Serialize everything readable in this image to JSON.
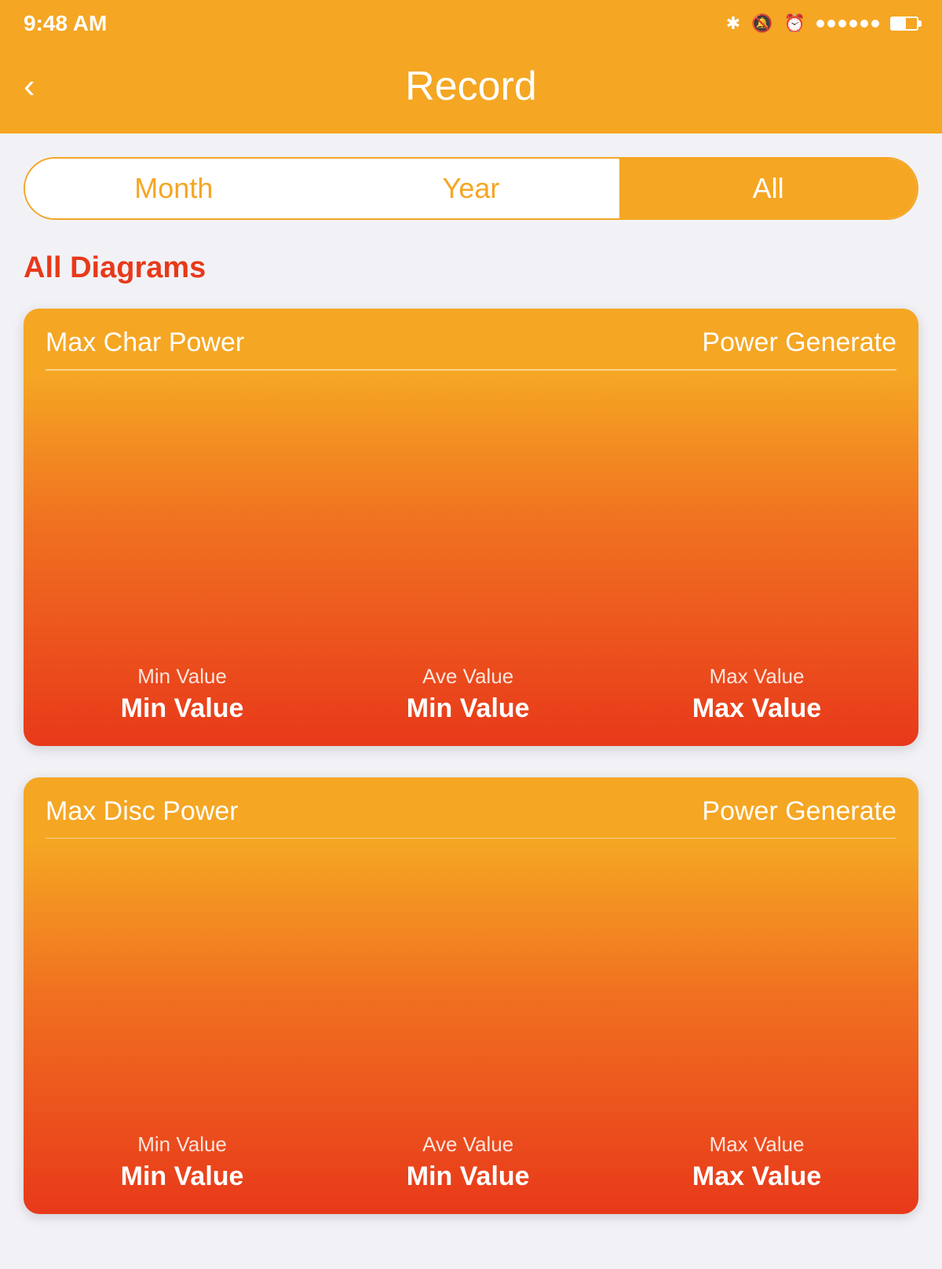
{
  "statusBar": {
    "time": "9:48 AM"
  },
  "navBar": {
    "backLabel": "‹",
    "title": "Record"
  },
  "tabs": [
    {
      "id": "month",
      "label": "Month",
      "active": false
    },
    {
      "id": "year",
      "label": "Year",
      "active": false
    },
    {
      "id": "all",
      "label": "All",
      "active": true
    }
  ],
  "sectionTitle": "All Diagrams",
  "cards": [
    {
      "id": "char-power",
      "titleLeft": "Max Char Power",
      "titleRight": "Power Generate",
      "stats": [
        {
          "label": "Min Value",
          "value": "Min Value"
        },
        {
          "label": "Ave Value",
          "value": "Min Value"
        },
        {
          "label": "Max Value",
          "value": "Max Value"
        }
      ]
    },
    {
      "id": "disc-power",
      "titleLeft": "Max Disc Power",
      "titleRight": "Power Generate",
      "stats": [
        {
          "label": "Min Value",
          "value": "Min Value"
        },
        {
          "label": "Ave Value",
          "value": "Min Value"
        },
        {
          "label": "Max Value",
          "value": "Max Value"
        }
      ]
    }
  ]
}
